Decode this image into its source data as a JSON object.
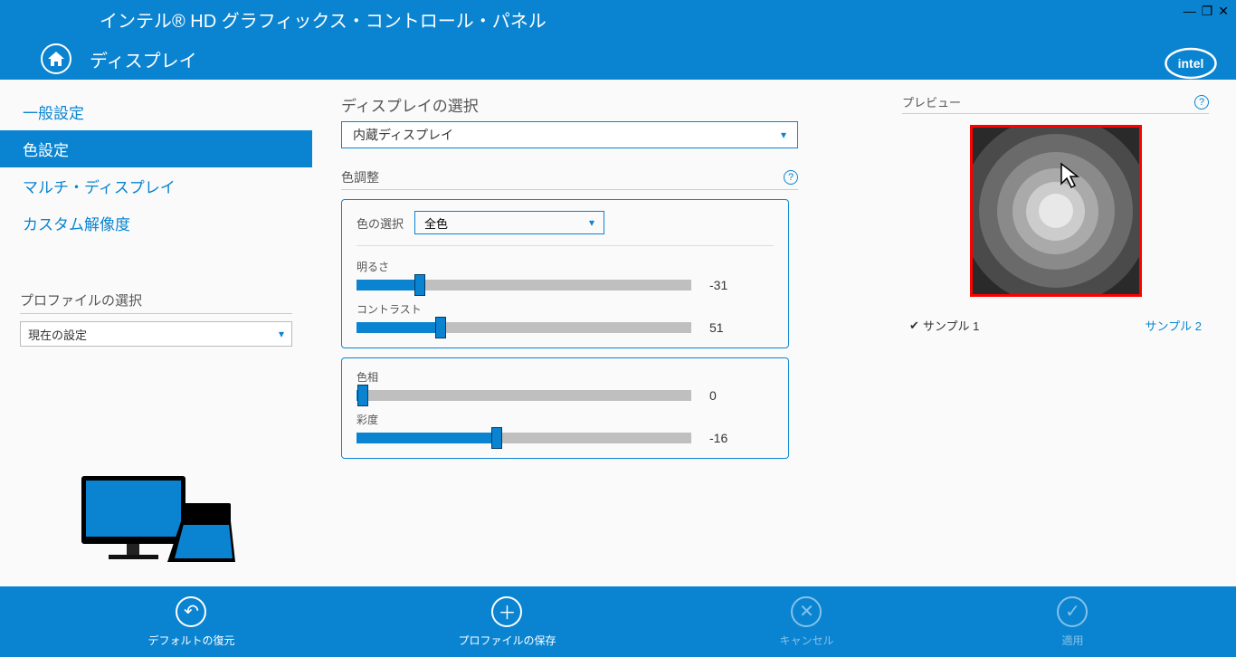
{
  "window": {
    "title": "インテル® HD グラフィックス・コントロール・パネル"
  },
  "nav": {
    "section": "ディスプレイ"
  },
  "sidebar": {
    "items": [
      {
        "label": "一般設定"
      },
      {
        "label": "色設定"
      },
      {
        "label": "マルチ・ディスプレイ"
      },
      {
        "label": "カスタム解像度"
      }
    ],
    "active_index": 1
  },
  "profile": {
    "label": "プロファイルの選択",
    "value": "現在の設定"
  },
  "main": {
    "display_select": {
      "label": "ディスプレイの選択",
      "value": "内蔵ディスプレイ"
    },
    "color_adjust_label": "色調整",
    "color_select": {
      "label": "色の選択",
      "value": "全色"
    },
    "sliders": {
      "brightness": {
        "label": "明るさ",
        "value": -31,
        "fill_pct": 19,
        "thumb_pct": 19
      },
      "contrast": {
        "label": "コントラスト",
        "value": 51,
        "fill_pct": 25,
        "thumb_pct": 25
      },
      "hue": {
        "label": "色相",
        "value": 0,
        "fill_pct": 2,
        "thumb_pct": 2
      },
      "saturation": {
        "label": "彩度",
        "value": -16,
        "fill_pct": 42,
        "thumb_pct": 42
      }
    }
  },
  "preview": {
    "label": "プレビュー",
    "sample1": "サンプル 1",
    "sample2": "サンプル 2"
  },
  "footer": {
    "restore": "デフォルトの復元",
    "save": "プロファイルの保存",
    "cancel": "キャンセル",
    "apply": "適用"
  }
}
